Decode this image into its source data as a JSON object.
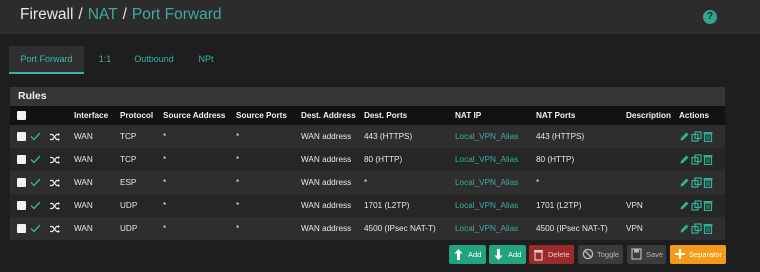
{
  "breadcrumb": {
    "part1": "Firewall",
    "part2": "NAT",
    "part3": "Port Forward",
    "separator": "/"
  },
  "help_icon": "?",
  "tabs": [
    {
      "label": "Port Forward",
      "active": true
    },
    {
      "label": "1:1",
      "active": false
    },
    {
      "label": "Outbound",
      "active": false
    },
    {
      "label": "NPt",
      "active": false
    }
  ],
  "panel": {
    "title": "Rules"
  },
  "table": {
    "columns": [
      "Interface",
      "Protocol",
      "Source Address",
      "Source Ports",
      "Dest. Address",
      "Dest. Ports",
      "NAT IP",
      "NAT Ports",
      "Description",
      "Actions"
    ],
    "rows": [
      {
        "interface": "WAN",
        "protocol": "TCP",
        "src_addr": "*",
        "src_ports": "*",
        "dst_addr": "WAN address",
        "dst_ports": "443 (HTTPS)",
        "nat_ip": "Local_VPN_Alias",
        "nat_ports": "443 (HTTPS)",
        "description": ""
      },
      {
        "interface": "WAN",
        "protocol": "TCP",
        "src_addr": "*",
        "src_ports": "*",
        "dst_addr": "WAN address",
        "dst_ports": "80 (HTTP)",
        "nat_ip": "Local_VPN_Alias",
        "nat_ports": "80 (HTTP)",
        "description": ""
      },
      {
        "interface": "WAN",
        "protocol": "ESP",
        "src_addr": "*",
        "src_ports": "*",
        "dst_addr": "WAN address",
        "dst_ports": "*",
        "nat_ip": "Local_VPN_Alias",
        "nat_ports": "*",
        "description": ""
      },
      {
        "interface": "WAN",
        "protocol": "UDP",
        "src_addr": "*",
        "src_ports": "*",
        "dst_addr": "WAN address",
        "dst_ports": "1701 (L2TP)",
        "nat_ip": "Local_VPN_Alias",
        "nat_ports": "1701 (L2TP)",
        "description": "VPN"
      },
      {
        "interface": "WAN",
        "protocol": "UDP",
        "src_addr": "*",
        "src_ports": "*",
        "dst_addr": "WAN address",
        "dst_ports": "4500 (IPsec NAT-T)",
        "nat_ip": "Local_VPN_Alias",
        "nat_ports": "4500 (IPsec NAT-T)",
        "description": "VPN"
      }
    ]
  },
  "buttons": {
    "add_top": "Add",
    "add_bottom": "Add",
    "delete": "Delete",
    "toggle": "Toggle",
    "save": "Save",
    "separator": "Separator"
  },
  "icons": [
    "check-icon",
    "shuffle-icon",
    "pencil-icon",
    "copy-icon",
    "trash-icon",
    "arrow-up-icon",
    "arrow-down-icon",
    "ban-icon",
    "floppy-icon",
    "plus-icon",
    "question-icon"
  ],
  "colors": {
    "accent": "#3aaea0",
    "header_bg": "#2c2c2c",
    "body_bg": "#1e1e1e",
    "button_green": "#21a37e",
    "button_red": "#9b2a2a",
    "button_orange": "#f39a1a"
  }
}
